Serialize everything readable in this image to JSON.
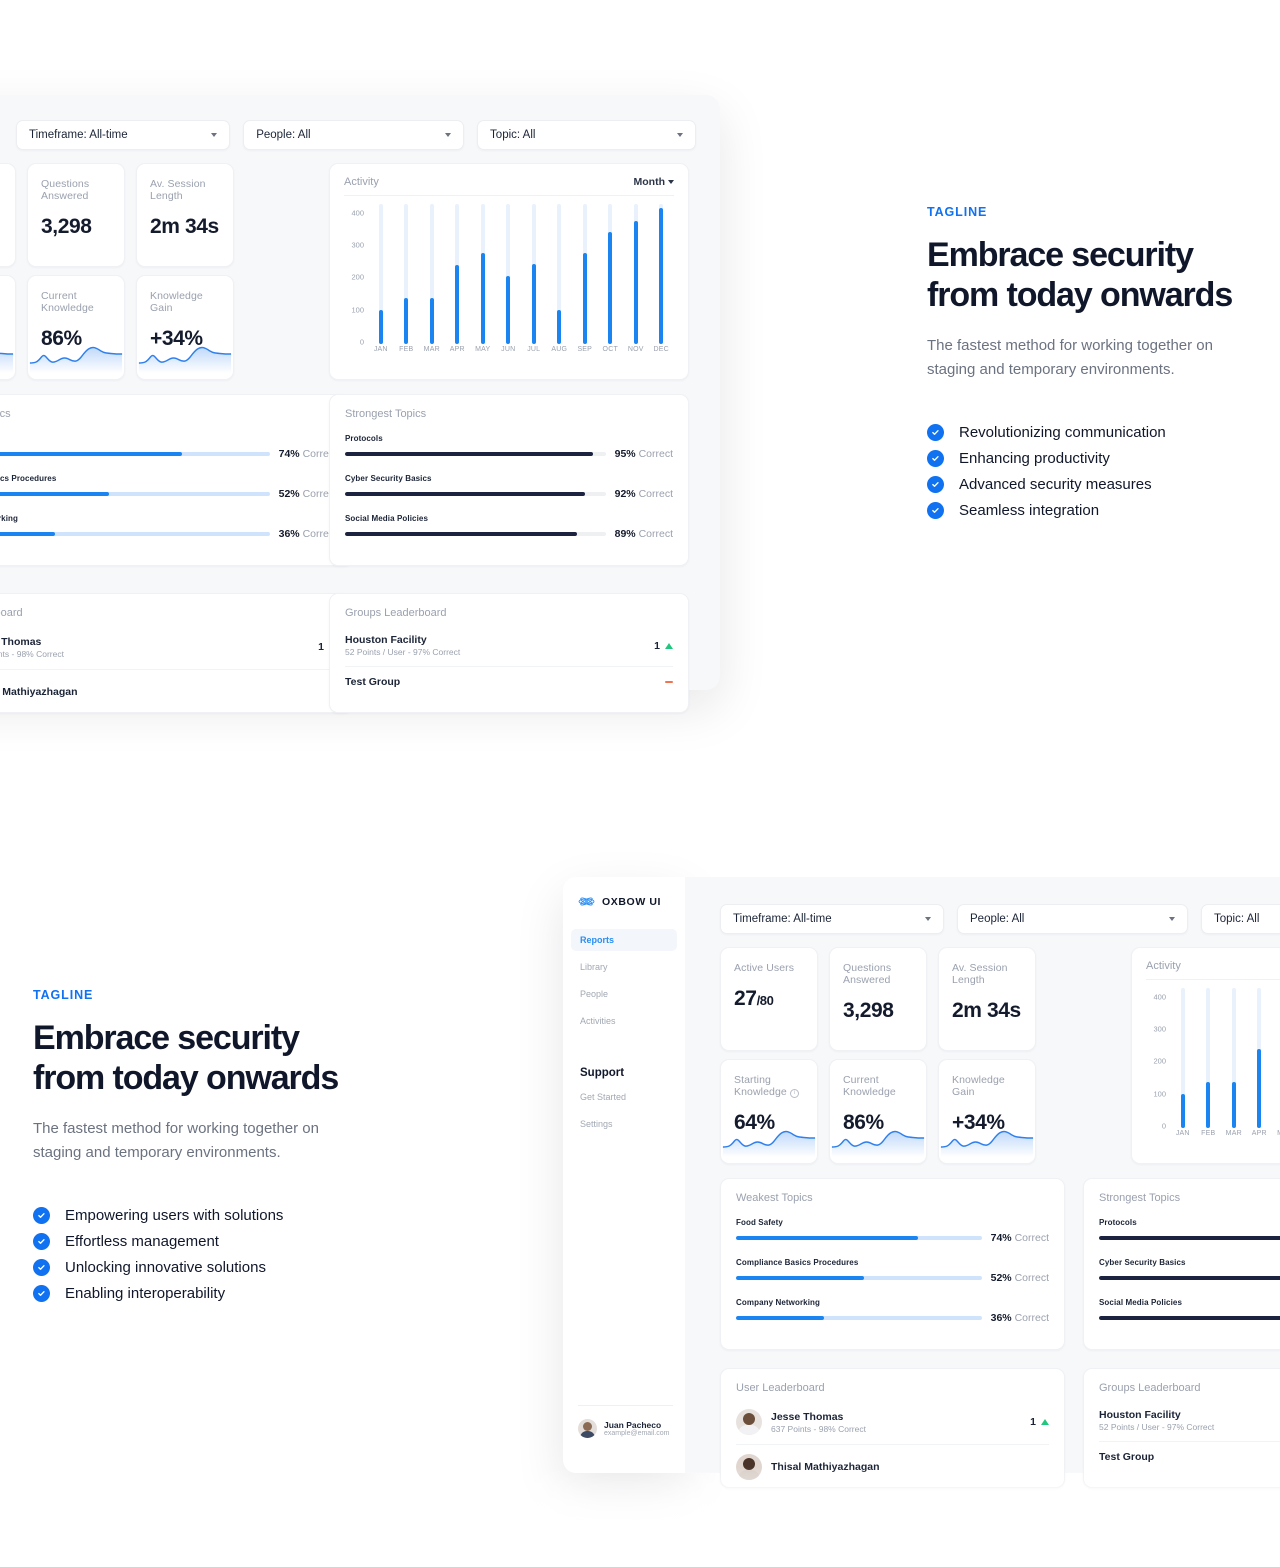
{
  "brand": {
    "accent": "#1072f0",
    "bar_blue": "#1a85f0",
    "navy": "#1c2340",
    "green": "#22c77f",
    "name": "OXBOW UI"
  },
  "marketing_top": {
    "tagline": "TAGLINE",
    "headline": "Embrace security from today onwards",
    "subcopy": "The fastest method for working together on staging and temporary environments.",
    "bullets": [
      "Revolutionizing communication",
      "Enhancing productivity",
      "Advanced security measures",
      "Seamless integration"
    ]
  },
  "marketing_bottom": {
    "tagline": "TAGLINE",
    "headline": "Embrace security from today onwards",
    "subcopy": "The fastest method for working together on staging and temporary environments.",
    "bullets": [
      "Empowering users with solutions",
      "Effortless management",
      "Unlocking innovative solutions",
      "Enabling interoperability"
    ]
  },
  "sidebar": {
    "logo_text": "OXBOW UI",
    "items": [
      {
        "label": "Reports",
        "active": true
      },
      {
        "label": "Library",
        "active": false
      },
      {
        "label": "People",
        "active": false
      },
      {
        "label": "Activities",
        "active": false
      }
    ],
    "section_label": "Support",
    "support_items": [
      {
        "label": "Get Started"
      },
      {
        "label": "Settings"
      }
    ],
    "user": {
      "name": "Juan Pacheco",
      "email": "example@email.com"
    }
  },
  "filters": [
    {
      "label": "Timeframe: All-time"
    },
    {
      "label": "People: All"
    },
    {
      "label": "Topic: All"
    }
  ],
  "stats": [
    {
      "label": "Active Users",
      "value": "27",
      "suffix": "/80",
      "has_info": false,
      "spark": false
    },
    {
      "label": "Questions Answered",
      "value": "3,298",
      "suffix": "",
      "has_info": false,
      "spark": false
    },
    {
      "label": "Av. Session Length",
      "value": "2m 34s",
      "suffix": "",
      "has_info": false,
      "spark": false
    },
    {
      "label": "Starting Knowledge",
      "value": "64%",
      "suffix": "",
      "has_info": true,
      "spark": true
    },
    {
      "label": "Current Knowledge",
      "value": "86%",
      "suffix": "",
      "has_info": false,
      "spark": true
    },
    {
      "label": "Knowledge Gain",
      "value": "+34%",
      "suffix": "",
      "has_info": false,
      "spark": true
    }
  ],
  "activity": {
    "title": "Activity",
    "range_label": "Month"
  },
  "chart_data": {
    "type": "bar",
    "title": "Activity",
    "xlabel": "",
    "ylabel": "",
    "ylim": [
      0,
      420
    ],
    "yticks": [
      0,
      100,
      200,
      300,
      400
    ],
    "grid": false,
    "legend": false,
    "track_max": 420,
    "categories": [
      "JAN",
      "FEB",
      "MAR",
      "APR",
      "MAY",
      "JUN",
      "JUL",
      "AUG",
      "SEP",
      "OCT",
      "NOV",
      "DEC"
    ],
    "values": [
      103,
      138,
      138,
      238,
      272,
      205,
      240,
      103,
      272,
      335,
      370,
      408
    ]
  },
  "weakest": {
    "title": "Weakest Topics",
    "unit": "Correct",
    "rows": [
      {
        "name": "Food Safety",
        "pct": 74
      },
      {
        "name": "Compliance Basics Procedures",
        "pct": 52
      },
      {
        "name": "Company Networking",
        "pct": 36
      }
    ]
  },
  "strongest": {
    "title": "Strongest Topics",
    "unit": "Correct",
    "rows": [
      {
        "name": "Protocols",
        "pct": 95
      },
      {
        "name": "Cyber Security Basics",
        "pct": 92
      },
      {
        "name": "Social Media Policies",
        "pct": 89
      }
    ]
  },
  "user_leaderboard": {
    "title": "User Leaderboard",
    "rows": [
      {
        "name": "Jesse Thomas",
        "sub": "637 Points - 98% Correct",
        "rank": "1",
        "trend": "up"
      },
      {
        "name": "Thisal Mathiyazhagan",
        "sub": "",
        "rank": "",
        "trend": "flat"
      }
    ]
  },
  "groups_leaderboard": {
    "title": "Groups Leaderboard",
    "rows": [
      {
        "name": "Houston Facility",
        "sub": "52 Points / User - 97% Correct",
        "rank": "1",
        "trend": "up"
      },
      {
        "name": "Test Group",
        "sub": "",
        "rank": "",
        "trend": "down"
      }
    ]
  }
}
